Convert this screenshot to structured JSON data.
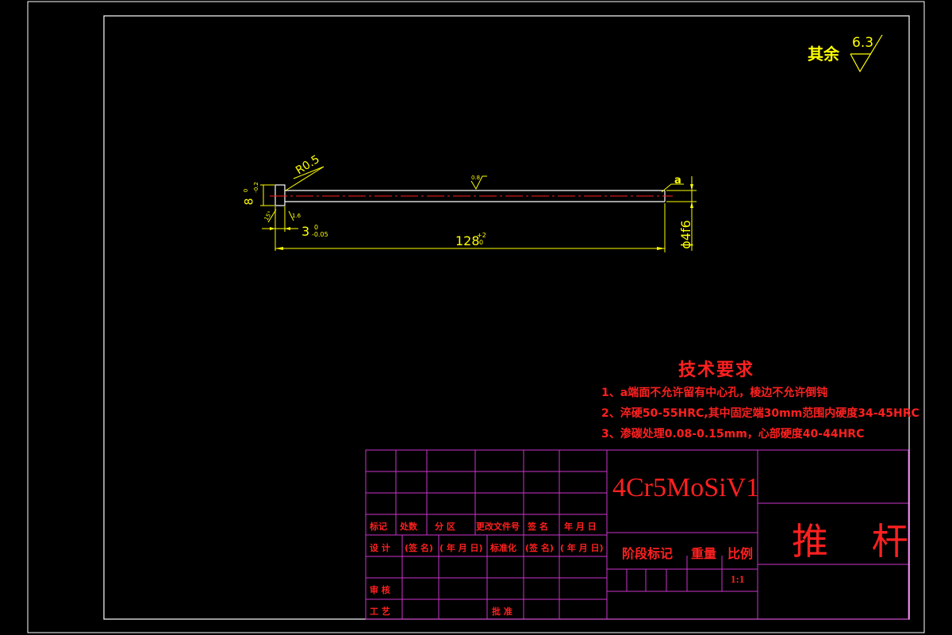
{
  "dimensions": {
    "radius": "R0.5",
    "roughness_top": "0.8",
    "head_height": "8",
    "head_height_tol": "-0.2",
    "head_height_tol_top": "0",
    "head_thickness": "3",
    "head_thickness_tol_top": "0",
    "head_thickness_tol_bottom": "-0.05",
    "length": "128",
    "length_tol_top": "+2",
    "length_tol_bottom": "0",
    "diameter": "ϕ4f6",
    "end_mark": "a",
    "small_left": "15°",
    "small_right": "1.6"
  },
  "surface_note": {
    "text": "其余",
    "value": "6.3"
  },
  "tech_requirements": {
    "title": "技术要求",
    "items": [
      "1、a端面不允许留有中心孔，棱边不允许倒钝",
      "2、淬硬50-55HRC,其中固定端30mm范围内硬度34-45HRC",
      "3、渗碳处理0.08-0.15mm，心部硬度40-44HRC"
    ]
  },
  "title_block": {
    "row1": [
      "标记",
      "处数",
      "分  区",
      "更改文件号",
      "签  名",
      "年 月 日"
    ],
    "row2": [
      "设  计",
      "(签  名)",
      "( 年 月 日)",
      "标准化",
      "(签  名)",
      "( 年 月 日)"
    ],
    "review": "审  核",
    "process": "工  艺",
    "approve": "批  准",
    "material": "4Cr5MoSiV1",
    "part_name": "推  杆",
    "stage_mark": "阶段标记",
    "weight": "重量",
    "ratio": "比例",
    "scale": "1:1"
  },
  "colors": {
    "frame": "#ffffff",
    "dimension": "#ffff00",
    "centerline": "#ff2020",
    "table_lines": "#cc33cc",
    "text": "#ff2020"
  }
}
